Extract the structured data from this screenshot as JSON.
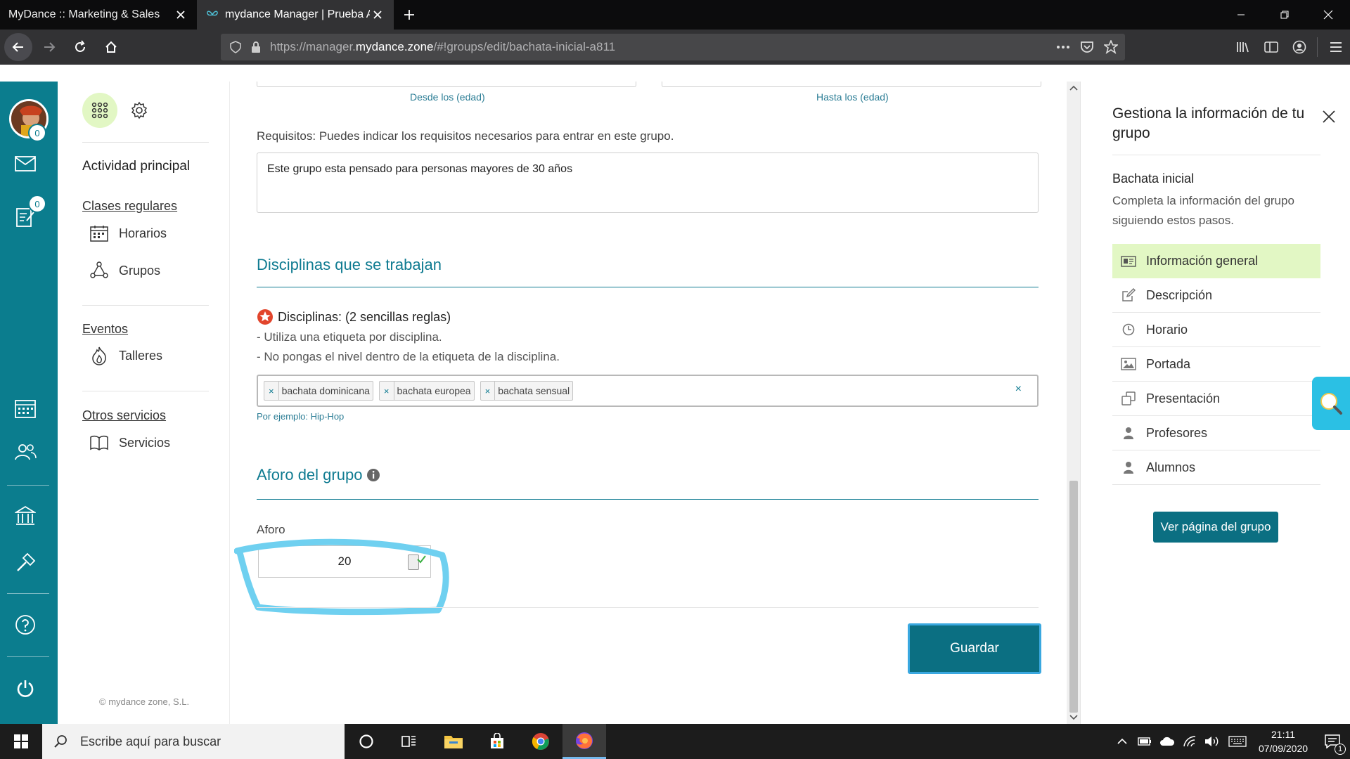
{
  "browser": {
    "tabs": [
      {
        "title": "MyDance :: Marketing & Sales",
        "active": false
      },
      {
        "title": "mydance Manager | Prueba Ale",
        "active": true
      }
    ],
    "url": {
      "prefix": "https://manager.",
      "host": "mydance.zone",
      "path": "/#!groups/edit/bachata-inicial-a811"
    },
    "colors": {
      "chrome": "#0c0c0d",
      "toolbar": "#323234"
    }
  },
  "leftbar": {
    "mail_count": "0",
    "notes_count": "0",
    "color": "#0b7d8e"
  },
  "nav": {
    "section_main": "Actividad principal",
    "group_regular": "Clases regulares",
    "item_horarios": "Horarios",
    "item_grupos": "Grupos",
    "group_events": "Eventos",
    "item_talleres": "Talleres",
    "group_other": "Otros servicios",
    "item_servicios": "Servicios",
    "footer": "© mydance zone, S.L."
  },
  "form": {
    "age_from_hint": "Desde los (edad)",
    "age_to_hint": "Hasta los (edad)",
    "requirements_label": "Requisitos: Puedes indicar los requisitos necesarios para entrar en este grupo.",
    "requirements_value": "Este grupo esta pensado para personas mayores de 30 años",
    "disciplines_title": "Disciplinas que se trabajan",
    "disciplines_heading": "Disciplinas: (2 sencillas reglas)",
    "rule_1": "- Utiliza una etiqueta por disciplina.",
    "rule_2": "- No pongas el nivel dentro de la etiqueta de la disciplina.",
    "tags": [
      "bachata dominicana",
      "bachata europea",
      "bachata sensual"
    ],
    "tags_clear": "×",
    "tag_remove": "×",
    "disciplines_example": "Por ejemplo: Hip-Hop",
    "capacity_title": "Aforo del grupo",
    "capacity_label": "Aforo",
    "capacity_value": "20",
    "save_label": "Guardar",
    "accent": "#0f7b91"
  },
  "right_panel": {
    "title": "Gestiona la información de tu grupo",
    "group_name": "Bachata inicial",
    "description": "Completa la información del grupo siguiendo estos pasos.",
    "steps": [
      {
        "label": "Información general",
        "icon": "id-card-icon",
        "active": true
      },
      {
        "label": "Descripción",
        "icon": "edit-icon",
        "active": false
      },
      {
        "label": "Horario",
        "icon": "clock-icon",
        "active": false
      },
      {
        "label": "Portada",
        "icon": "image-icon",
        "active": false
      },
      {
        "label": "Presentación",
        "icon": "copy-icon",
        "active": false
      },
      {
        "label": "Profesores",
        "icon": "user-icon",
        "active": false
      },
      {
        "label": "Alumnos",
        "icon": "user-icon",
        "active": false
      }
    ],
    "view_button": "Ver página del grupo",
    "highlight": "#e2f7c4"
  },
  "taskbar": {
    "search_placeholder": "Escribe aquí para buscar",
    "time": "21:11",
    "date": "07/09/2020",
    "notifications": "1"
  }
}
